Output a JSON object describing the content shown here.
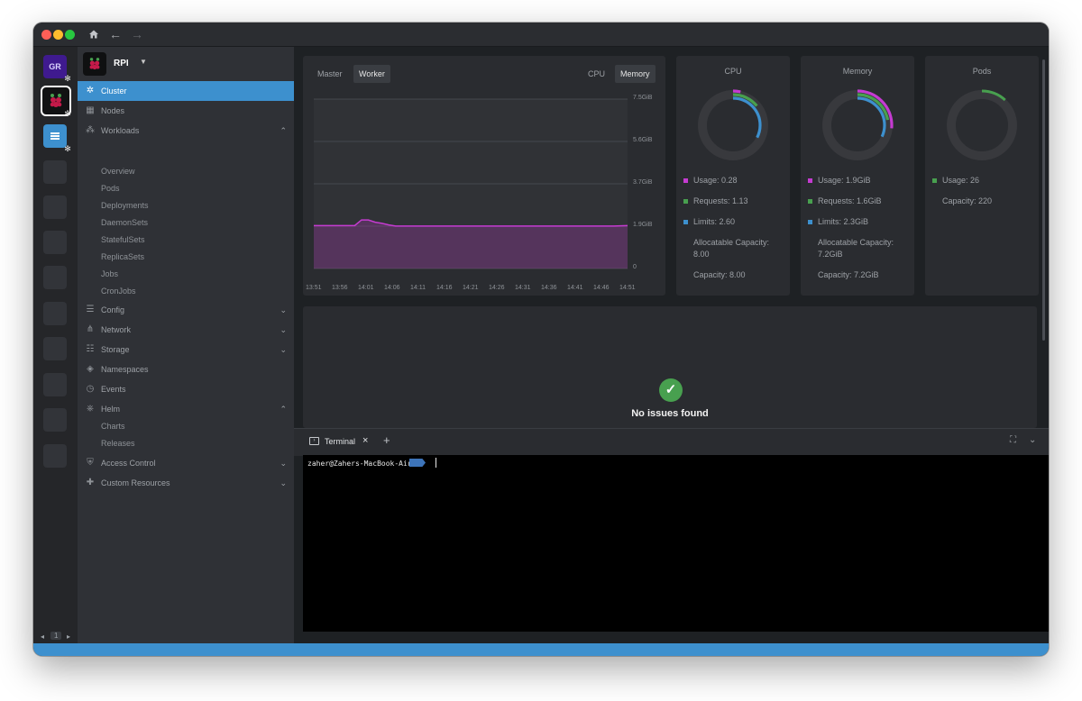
{
  "hotbar": {
    "gr_label": "GR",
    "pager": {
      "page": "1"
    }
  },
  "cluster": {
    "name": "RPI"
  },
  "sidebar": {
    "items": [
      {
        "label": "Cluster",
        "icon": "cluster-icon",
        "active": true
      },
      {
        "label": "Nodes",
        "icon": "nodes-icon"
      },
      {
        "label": "Workloads",
        "icon": "workloads-icon",
        "chevron": "up",
        "children": [
          "Overview",
          "Pods",
          "Deployments",
          "DaemonSets",
          "StatefulSets",
          "ReplicaSets",
          "Jobs",
          "CronJobs"
        ]
      },
      {
        "label": "Config",
        "icon": "config-icon",
        "chevron": "down"
      },
      {
        "label": "Network",
        "icon": "network-icon",
        "chevron": "down"
      },
      {
        "label": "Storage",
        "icon": "storage-icon",
        "chevron": "down"
      },
      {
        "label": "Namespaces",
        "icon": "namespaces-icon"
      },
      {
        "label": "Events",
        "icon": "events-icon"
      },
      {
        "label": "Helm",
        "icon": "helm-icon",
        "chevron": "up",
        "children": [
          "Charts",
          "Releases"
        ]
      },
      {
        "label": "Access Control",
        "icon": "access-control-icon",
        "chevron": "down"
      },
      {
        "label": "Custom Resources",
        "icon": "custom-resources-icon",
        "chevron": "down"
      }
    ]
  },
  "chart_panel": {
    "node_tabs": [
      "Master",
      "Worker"
    ],
    "active_node_tab": "Worker",
    "metric_tabs": [
      "CPU",
      "Memory"
    ],
    "active_metric_tab": "Memory"
  },
  "chart_data": {
    "type": "area",
    "series": [
      {
        "values": [
          1.9,
          1.9,
          1.9,
          1.9,
          1.9,
          1.9,
          1.9,
          2.15,
          2.15,
          2.05,
          2.0,
          1.93,
          1.88,
          1.88,
          1.88,
          1.88,
          1.88,
          1.88,
          1.88,
          1.88,
          1.88,
          1.88,
          1.88,
          1.88,
          1.88,
          1.88,
          1.88,
          1.88,
          1.88,
          1.88,
          1.88,
          1.88,
          1.88,
          1.88,
          1.88,
          1.88,
          1.88,
          1.88,
          1.88,
          1.88,
          1.88,
          1.88,
          1.88,
          1.88,
          1.88,
          1.89,
          1.9
        ]
      }
    ],
    "ytick_labels": [
      "7.5GiB",
      "5.6GiB",
      "3.7GiB",
      "1.9GiB",
      "0"
    ],
    "ylim": [
      0,
      7.5
    ],
    "xtick_labels": [
      "13:51",
      "13:56",
      "14:01",
      "14:06",
      "14:11",
      "14:16",
      "14:21",
      "14:26",
      "14:31",
      "14:36",
      "14:41",
      "14:46",
      "14:51"
    ],
    "grid": true,
    "color": "#c53bd1"
  },
  "rings": [
    {
      "title": "CPU",
      "arcs": [
        {
          "fraction": 0.035,
          "color": "#c53bd1"
        },
        {
          "fraction": 0.141,
          "color": "#48a04f"
        },
        {
          "fraction": 0.325,
          "color": "#3d90ce"
        }
      ],
      "legend": [
        {
          "label": "Usage: 0.28",
          "color": "#c53bd1"
        },
        {
          "label": "Requests: 1.13",
          "color": "#48a04f"
        },
        {
          "label": "Limits: 2.60",
          "color": "#3d90ce"
        },
        {
          "label": "Allocatable Capacity: 8.00",
          "color": "#2a2c30"
        },
        {
          "label": "Capacity: 8.00",
          "color": "#2a2c30"
        }
      ]
    },
    {
      "title": "Memory",
      "arcs": [
        {
          "fraction": 0.264,
          "color": "#c53bd1"
        },
        {
          "fraction": 0.222,
          "color": "#48a04f"
        },
        {
          "fraction": 0.319,
          "color": "#3d90ce"
        }
      ],
      "legend": [
        {
          "label": "Usage: 1.9GiB",
          "color": "#c53bd1"
        },
        {
          "label": "Requests: 1.6GiB",
          "color": "#48a04f"
        },
        {
          "label": "Limits: 2.3GiB",
          "color": "#3d90ce"
        },
        {
          "label": "Allocatable Capacity: 7.2GiB",
          "color": "#2a2c30"
        },
        {
          "label": "Capacity: 7.2GiB",
          "color": "#2a2c30"
        }
      ]
    },
    {
      "title": "Pods",
      "arcs": [
        {
          "fraction": 0.118,
          "color": "#48a04f"
        }
      ],
      "legend": [
        {
          "label": "Usage: 26",
          "color": "#48a04f"
        },
        {
          "label": "Capacity: 220",
          "color": "#2a2c30"
        }
      ]
    }
  ],
  "issues": {
    "message": "No issues found"
  },
  "dock": {
    "tab_label": "Terminal",
    "add_label": "+",
    "close_label": "×"
  },
  "terminal": {
    "prompt": "zaher@Zahers-MacBook-Air"
  }
}
